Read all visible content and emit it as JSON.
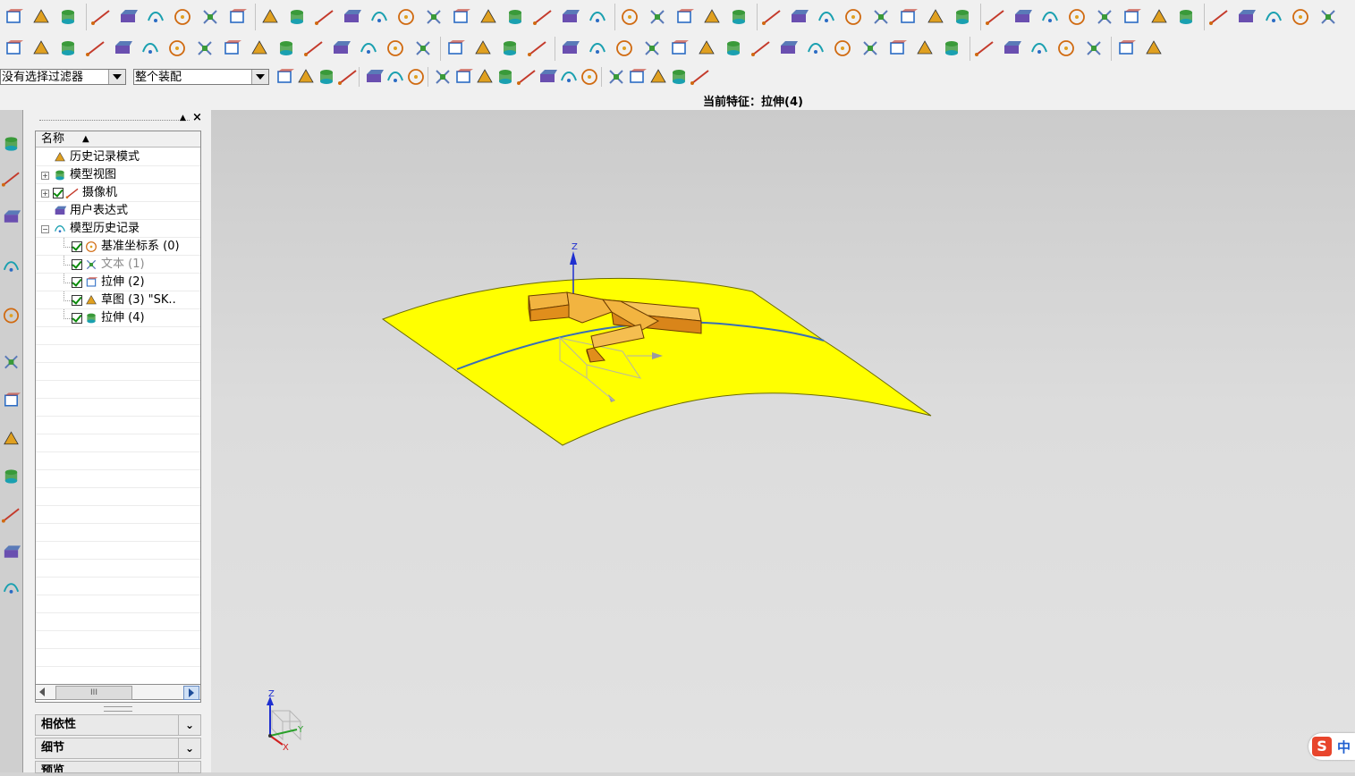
{
  "toolbar_row1": {
    "icons": [
      "new-file-icon",
      "part-navigator-icon",
      "assembly-icon",
      "block-icon",
      "cylinder-icon",
      "cone-icon",
      "sphere-icon",
      "tube-icon",
      "pad-icon",
      "extrude-icon",
      "revolve-icon",
      "sweep-icon",
      "hole-icon",
      "boss-icon",
      "pocket-icon",
      "edge-blend-icon",
      "chamfer-icon",
      "shell-icon",
      "draft-icon",
      "trim-body-icon",
      "sew-icon",
      "offset-face-icon",
      "thicken-icon",
      "mirror-icon",
      "pattern-icon",
      "surface-icon",
      "mesh-surface-icon",
      "studio-surface-icon",
      "through-curves-icon",
      "through-curve-mesh-icon",
      "swept-surface-icon",
      "n-sided-surface-icon",
      "bridge-surface-icon",
      "extension-icon",
      "law-extension-icon",
      "offset-surface-icon",
      "sketch-plane-icon",
      "datum-plane-icon",
      "datum-axis-icon",
      "datum-csys-icon",
      "point-icon",
      "layer-icon",
      "wcs-icon",
      "transform-icon",
      "assembly-add-icon",
      "assembly-constraint-icon",
      "assembly-move-icon",
      "explode-icon",
      "reference-set-icon"
    ]
  },
  "toolbar_row2": {
    "icons": [
      "line-icon",
      "arc-icon",
      "rectangle-icon",
      "spline-icon",
      "text-icon",
      "polygon-icon",
      "helix-icon",
      "law-curve-icon",
      "offset-curve-icon",
      "project-curve-icon",
      "intersect-curve-icon",
      "isoparametric-icon",
      "extract-curve-icon",
      "wrap-curve-icon",
      "bridge-curve-icon",
      "join-curve-icon",
      "divide-curve-icon",
      "trim-curve-icon",
      "fillet-curve-icon",
      "chamfer-curve-icon",
      "snap-icon",
      "line-sketch-icon",
      "perpendicular-icon",
      "parallel-icon",
      "tangent-icon",
      "circle-tool-icon",
      "ellipse-icon",
      "spline-tool-icon",
      "conic-icon",
      "grid-icon",
      "edit-curve-icon",
      "edit-arc-icon",
      "edit-parameters-icon",
      "stretch-icon",
      "circle-center-icon",
      "circle-3point-icon",
      "circle-tangent-icon",
      "circle-radius-icon",
      "point-on-curve-icon",
      "point-at-angle-icon",
      "point-quadrant-icon",
      "render-icon"
    ]
  },
  "toolbar_row3": {
    "filter_select": "没有选择过滤器",
    "scope_select": "整个装配",
    "icons": [
      "filter-settings-icon",
      "select-feature-icon",
      "undo-select-icon",
      "select-body-icon",
      "select-face-icon",
      "select-edge-icon",
      "select-curve-icon",
      "select-rectangle-icon",
      "snap-endpoint-icon",
      "snap-midpoint-icon",
      "snap-control-icon",
      "snap-intersection-icon",
      "snap-arc-center-icon",
      "snap-quadrant-icon",
      "snap-existing-icon",
      "snap-point-on-curve-icon",
      "snap-point-on-face-icon",
      "snap-bounded-icon",
      "snap-curve-icon",
      "view-orient-icon"
    ]
  },
  "status": {
    "current_feature": "当前特征：拉伸(4)"
  },
  "resource_bar": {
    "icons": [
      "assembly-navigator-icon",
      "constraint-navigator-icon",
      "part-navigator-icon",
      "reuse-library-icon",
      "hd3d-icon",
      "web-browser-icon",
      "history-icon",
      "process-studio-icon",
      "visual-report-icon",
      "manufacturing-wizard-icon",
      "roles-icon",
      "system-materials-icon"
    ]
  },
  "navigator": {
    "column_header": "名称",
    "sort_indicator": "▲",
    "rows": [
      {
        "label": "历史记录模式",
        "icon": "clock-icon",
        "indent": 1,
        "checked": false,
        "expander": "",
        "muted": false
      },
      {
        "label": "模型视图",
        "icon": "model-view-icon",
        "indent": 1,
        "checked": false,
        "expander": "+",
        "muted": false
      },
      {
        "label": "摄像机",
        "icon": "camera-icon",
        "indent": 1,
        "checked": true,
        "expander": "+",
        "muted": false
      },
      {
        "label": "用户表达式",
        "icon": "folder-icon",
        "indent": 1,
        "checked": false,
        "expander": "",
        "muted": false
      },
      {
        "label": "模型历史记录",
        "icon": "folder-open-icon",
        "indent": 1,
        "checked": false,
        "expander": "−",
        "muted": false
      },
      {
        "label": "基准坐标系 (0)",
        "icon": "datum-csys-icon",
        "indent": 2,
        "checked": true,
        "expander": "",
        "muted": false
      },
      {
        "label": "文本 (1)",
        "icon": "text-a-icon",
        "indent": 2,
        "checked": true,
        "expander": "",
        "muted": true
      },
      {
        "label": "拉伸 (2)",
        "icon": "extrude-feature-icon",
        "indent": 2,
        "checked": true,
        "expander": "",
        "muted": false
      },
      {
        "label": "草图 (3) \"SK..",
        "icon": "sketch-feature-icon",
        "indent": 2,
        "checked": true,
        "expander": "",
        "muted": false
      },
      {
        "label": "拉伸 (4)",
        "icon": "extrude-feature-icon",
        "indent": 2,
        "checked": true,
        "expander": "",
        "muted": false
      }
    ],
    "panels": [
      {
        "label": "相依性"
      },
      {
        "label": "细节"
      },
      {
        "label": "预览"
      }
    ],
    "scroll_glyph": "III"
  },
  "viewport": {
    "axis_z": "Z",
    "axis_y": "Y",
    "axis_x": "X",
    "surface_color": "#ffff00",
    "solid_color": "#e8a020"
  },
  "ime": {
    "label": "中"
  }
}
